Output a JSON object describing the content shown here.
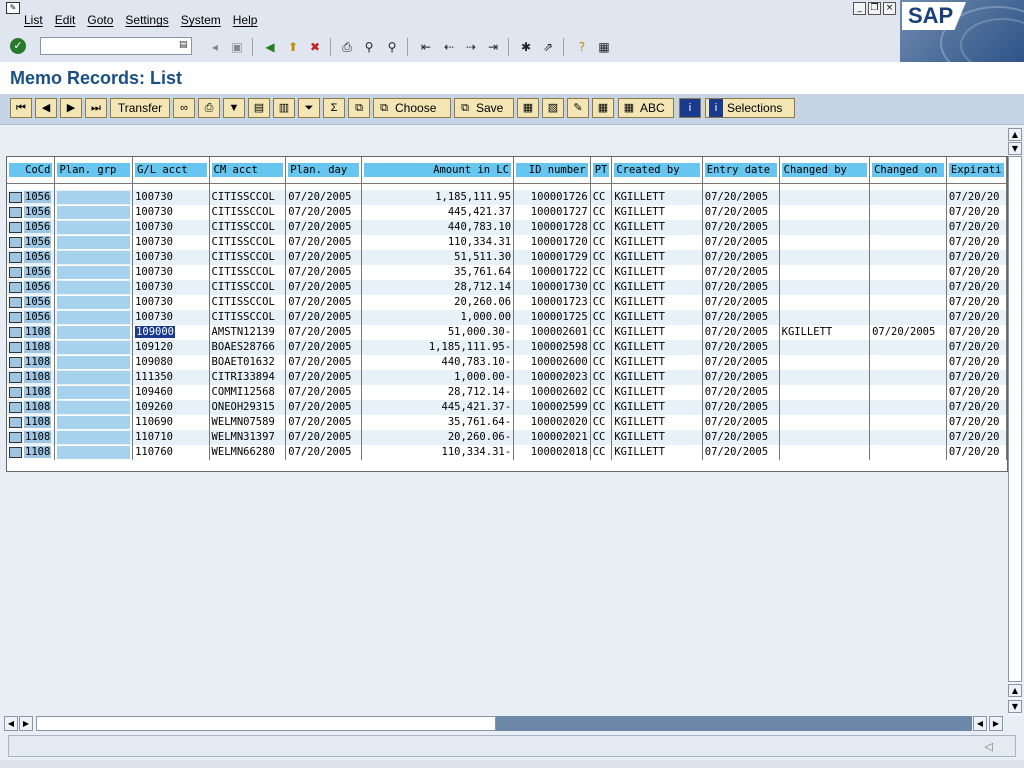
{
  "menubar": {
    "items": [
      "List",
      "Edit",
      "Goto",
      "Settings",
      "System",
      "Help"
    ],
    "logo": "SAP"
  },
  "toolbar": {
    "command_value": "",
    "icons": [
      "back-icon",
      "exit-icon",
      "cancel-icon",
      "print-icon",
      "find-icon",
      "find-next-icon",
      "first-page-icon",
      "previous-page-icon",
      "next-page-icon",
      "last-page-icon",
      "create-session-icon",
      "shortcut-icon",
      "help-icon",
      "layout-icon"
    ]
  },
  "title": "Memo Records: List",
  "app_toolbar": {
    "transfer": "Transfer",
    "choose": "Choose",
    "save": "Save",
    "abc": "ABC",
    "selections": "Selections"
  },
  "grid": {
    "columns": [
      "CoCd",
      "Plan. grp",
      "G/L acct",
      "CM acct",
      "Plan. day",
      "Amount in LC",
      "ID number",
      "PT",
      "Created by",
      "Entry date",
      "Changed by",
      "Changed on",
      "Expirati"
    ],
    "rows": [
      {
        "cocd": "1056",
        "gl": "100730",
        "cm": "CITISSCCOL",
        "day": "07/20/2005",
        "amount": "1,185,111.95",
        "id": "100001726",
        "pt": "CC",
        "created": "KGILLETT",
        "entry": "07/20/2005",
        "changed_by": "",
        "changed_on": "",
        "exp": "07/20/20"
      },
      {
        "cocd": "1056",
        "gl": "100730",
        "cm": "CITISSCCOL",
        "day": "07/20/2005",
        "amount": "445,421.37",
        "id": "100001727",
        "pt": "CC",
        "created": "KGILLETT",
        "entry": "07/20/2005",
        "changed_by": "",
        "changed_on": "",
        "exp": "07/20/20"
      },
      {
        "cocd": "1056",
        "gl": "100730",
        "cm": "CITISSCCOL",
        "day": "07/20/2005",
        "amount": "440,783.10",
        "id": "100001728",
        "pt": "CC",
        "created": "KGILLETT",
        "entry": "07/20/2005",
        "changed_by": "",
        "changed_on": "",
        "exp": "07/20/20"
      },
      {
        "cocd": "1056",
        "gl": "100730",
        "cm": "CITISSCCOL",
        "day": "07/20/2005",
        "amount": "110,334.31",
        "id": "100001720",
        "pt": "CC",
        "created": "KGILLETT",
        "entry": "07/20/2005",
        "changed_by": "",
        "changed_on": "",
        "exp": "07/20/20"
      },
      {
        "cocd": "1056",
        "gl": "100730",
        "cm": "CITISSCCOL",
        "day": "07/20/2005",
        "amount": "51,511.30",
        "id": "100001729",
        "pt": "CC",
        "created": "KGILLETT",
        "entry": "07/20/2005",
        "changed_by": "",
        "changed_on": "",
        "exp": "07/20/20"
      },
      {
        "cocd": "1056",
        "gl": "100730",
        "cm": "CITISSCCOL",
        "day": "07/20/2005",
        "amount": "35,761.64",
        "id": "100001722",
        "pt": "CC",
        "created": "KGILLETT",
        "entry": "07/20/2005",
        "changed_by": "",
        "changed_on": "",
        "exp": "07/20/20"
      },
      {
        "cocd": "1056",
        "gl": "100730",
        "cm": "CITISSCCOL",
        "day": "07/20/2005",
        "amount": "28,712.14",
        "id": "100001730",
        "pt": "CC",
        "created": "KGILLETT",
        "entry": "07/20/2005",
        "changed_by": "",
        "changed_on": "",
        "exp": "07/20/20"
      },
      {
        "cocd": "1056",
        "gl": "100730",
        "cm": "CITISSCCOL",
        "day": "07/20/2005",
        "amount": "20,260.06",
        "id": "100001723",
        "pt": "CC",
        "created": "KGILLETT",
        "entry": "07/20/2005",
        "changed_by": "",
        "changed_on": "",
        "exp": "07/20/20"
      },
      {
        "cocd": "1056",
        "gl": "100730",
        "cm": "CITISSCCOL",
        "day": "07/20/2005",
        "amount": "1,000.00",
        "id": "100001725",
        "pt": "CC",
        "created": "KGILLETT",
        "entry": "07/20/2005",
        "changed_by": "",
        "changed_on": "",
        "exp": "07/20/20"
      },
      {
        "cocd": "1108",
        "gl": "109000",
        "cm": "AMSTN12139",
        "day": "07/20/2005",
        "amount": "51,000.30-",
        "id": "100002601",
        "pt": "CC",
        "created": "KGILLETT",
        "entry": "07/20/2005",
        "changed_by": "KGILLETT",
        "changed_on": "07/20/2005",
        "exp": "07/20/20",
        "selected": true
      },
      {
        "cocd": "1108",
        "gl": "109120",
        "cm": "BOAES28766",
        "day": "07/20/2005",
        "amount": "1,185,111.95-",
        "id": "100002598",
        "pt": "CC",
        "created": "KGILLETT",
        "entry": "07/20/2005",
        "changed_by": "",
        "changed_on": "",
        "exp": "07/20/20"
      },
      {
        "cocd": "1108",
        "gl": "109080",
        "cm": "BOAET01632",
        "day": "07/20/2005",
        "amount": "440,783.10-",
        "id": "100002600",
        "pt": "CC",
        "created": "KGILLETT",
        "entry": "07/20/2005",
        "changed_by": "",
        "changed_on": "",
        "exp": "07/20/20"
      },
      {
        "cocd": "1108",
        "gl": "111350",
        "cm": "CITRI33894",
        "day": "07/20/2005",
        "amount": "1,000.00-",
        "id": "100002023",
        "pt": "CC",
        "created": "KGILLETT",
        "entry": "07/20/2005",
        "changed_by": "",
        "changed_on": "",
        "exp": "07/20/20"
      },
      {
        "cocd": "1108",
        "gl": "109460",
        "cm": "COMMI12568",
        "day": "07/20/2005",
        "amount": "28,712.14-",
        "id": "100002602",
        "pt": "CC",
        "created": "KGILLETT",
        "entry": "07/20/2005",
        "changed_by": "",
        "changed_on": "",
        "exp": "07/20/20"
      },
      {
        "cocd": "1108",
        "gl": "109260",
        "cm": "ONEOH29315",
        "day": "07/20/2005",
        "amount": "445,421.37-",
        "id": "100002599",
        "pt": "CC",
        "created": "KGILLETT",
        "entry": "07/20/2005",
        "changed_by": "",
        "changed_on": "",
        "exp": "07/20/20"
      },
      {
        "cocd": "1108",
        "gl": "110690",
        "cm": "WELMN07589",
        "day": "07/20/2005",
        "amount": "35,761.64-",
        "id": "100002020",
        "pt": "CC",
        "created": "KGILLETT",
        "entry": "07/20/2005",
        "changed_by": "",
        "changed_on": "",
        "exp": "07/20/20"
      },
      {
        "cocd": "1108",
        "gl": "110710",
        "cm": "WELMN31397",
        "day": "07/20/2005",
        "amount": "20,260.06-",
        "id": "100002021",
        "pt": "CC",
        "created": "KGILLETT",
        "entry": "07/20/2005",
        "changed_by": "",
        "changed_on": "",
        "exp": "07/20/20"
      },
      {
        "cocd": "1108",
        "gl": "110760",
        "cm": "WELMN66280",
        "day": "07/20/2005",
        "amount": "110,334.31-",
        "id": "100002018",
        "pt": "CC",
        "created": "KGILLETT",
        "entry": "07/20/2005",
        "changed_by": "",
        "changed_on": "",
        "exp": "07/20/20"
      }
    ]
  },
  "colors": {
    "header_fill": "#66c6ef",
    "title_color": "#1a4f86",
    "button_fill": "#f3e6b4"
  }
}
